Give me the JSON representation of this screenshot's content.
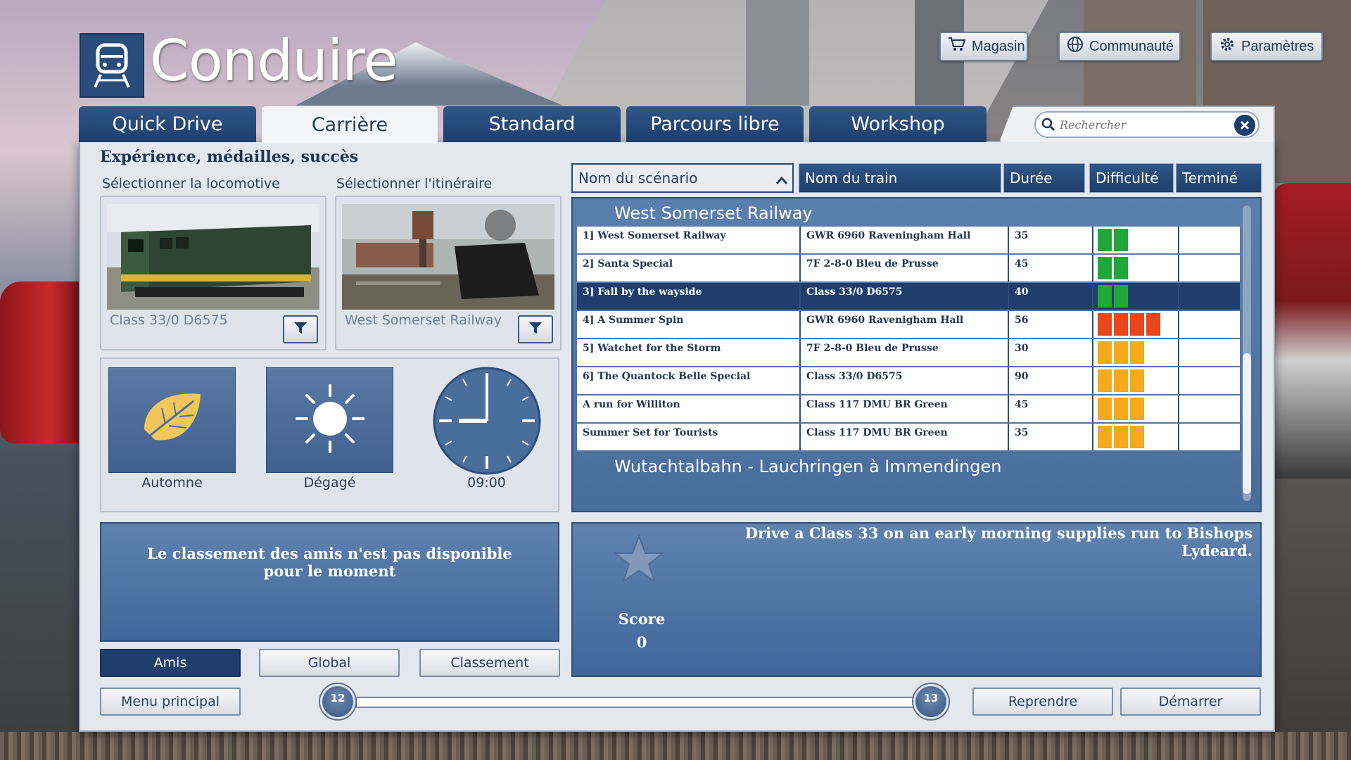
{
  "app": {
    "title": "Conduire",
    "logo_icon": "train-icon"
  },
  "topbar": {
    "shop": {
      "label": "Magasin",
      "icon": "cart-icon"
    },
    "community": {
      "label": "Communauté",
      "icon": "globe-icon"
    },
    "settings": {
      "label": "Paramètres",
      "icon": "gear-icon"
    }
  },
  "tabs": [
    {
      "label": "Quick Drive",
      "active": false
    },
    {
      "label": "Carrière",
      "active": true
    },
    {
      "label": "Standard",
      "active": false
    },
    {
      "label": "Parcours libre",
      "active": false
    },
    {
      "label": "Workshop",
      "active": false
    }
  ],
  "search": {
    "placeholder": "Rechercher",
    "value": ""
  },
  "left": {
    "section_title": "Expérience, médailles, succès",
    "loco_label": "Sélectionner la locomotive",
    "route_label": "Sélectionner l'itinéraire",
    "loco_caption": "Class 33/0 D6575",
    "route_caption": "West Somerset Railway",
    "conditions": {
      "season": "Automne",
      "weather": "Dégagé",
      "time": "09:00"
    },
    "friends_message": "Le classement des amis n'est pas disponible pour le moment",
    "leaderboard_buttons": [
      "Amis",
      "Global",
      "Classement"
    ]
  },
  "table": {
    "columns": [
      "Nom du scénario",
      "Nom du train",
      "Durée",
      "Difficulté",
      "Terminé"
    ],
    "groups": [
      "West Somerset Railway",
      "Wutachtalbahn - Lauchringen à Immendingen"
    ],
    "rows": [
      {
        "scenario": "1] West Somerset Railway",
        "train": "GWR 6960 Raveningham Hall",
        "duration": "35",
        "difficulty": 2,
        "color": "#22a63a",
        "selected": false
      },
      {
        "scenario": "2] Santa Special",
        "train": "7F 2-8-0 Bleu de Prusse",
        "duration": "45",
        "difficulty": 2,
        "color": "#22a63a",
        "selected": false
      },
      {
        "scenario": "3] Fall by the wayside",
        "train": "Class 33/0 D6575",
        "duration": "40",
        "difficulty": 2,
        "color": "#22a63a",
        "selected": true
      },
      {
        "scenario": "4] A Summer Spin",
        "train": "GWR 6960 Ravenigham Hall",
        "duration": "56",
        "difficulty": 4,
        "color": "#e8461c",
        "selected": false
      },
      {
        "scenario": "5] Watchet for the Storm",
        "train": "7F 2-8-0 Bleu de Prusse",
        "duration": "30",
        "difficulty": 3,
        "color": "#f5a91c",
        "selected": false
      },
      {
        "scenario": "6] The Quantock Belle Special",
        "train": "Class 33/0 D6575",
        "duration": "90",
        "difficulty": 3,
        "color": "#f5a91c",
        "selected": false
      },
      {
        "scenario": "A run for Williton",
        "train": "Class 117 DMU BR Green",
        "duration": "45",
        "difficulty": 3,
        "color": "#f5a91c",
        "selected": false
      },
      {
        "scenario": "Summer Set for Tourists",
        "train": "Class 117 DMU BR Green",
        "duration": "35",
        "difficulty": 3,
        "color": "#f5a91c",
        "selected": false
      }
    ]
  },
  "detail": {
    "description": "Drive a Class 33 on an early morning supplies run to Bishops Lydeard.",
    "score_label": "Score",
    "score_value": "0"
  },
  "bottom": {
    "main_menu": "Menu principal",
    "resume": "Reprendre",
    "start": "Démarrer",
    "level_current": "12",
    "level_next": "13",
    "level_progress": 0.03
  },
  "colors": {
    "accent": "#1e3f6c",
    "panel": "#e3e7ee",
    "tile": "#4a6e9c"
  }
}
